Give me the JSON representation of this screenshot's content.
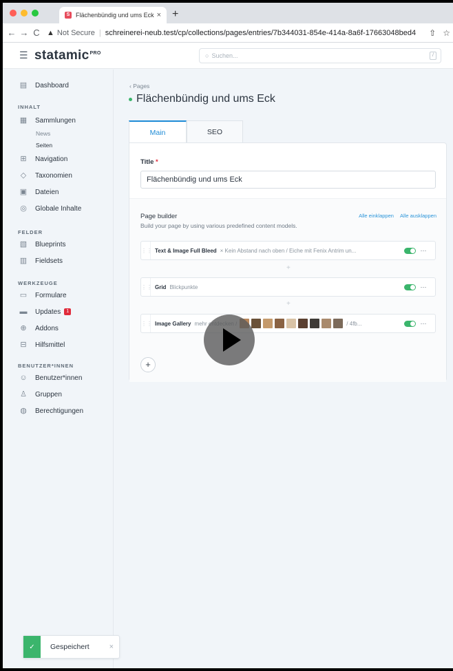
{
  "browser": {
    "tab_title": "Flächenbündig und ums Eck",
    "tab_title_suffix": "‹ |",
    "tab_close": "×",
    "new_tab": "+",
    "security_label": "Not Secure",
    "url": "schreinerei-neub.test/cp/collections/pages/entries/7b344031-854e-414a-8a6f-17663048bed4",
    "favicon_letter": "S"
  },
  "app": {
    "logo": "statamic",
    "logo_badge": "PRO",
    "search_placeholder": "Suchen...",
    "search_shortcut": "/"
  },
  "sidebar": {
    "dashboard": "Dashboard",
    "section_content": "INHALT",
    "collections": "Sammlungen",
    "sub_news": "News",
    "sub_pages": "Seiten",
    "navigation": "Navigation",
    "taxonomies": "Taxonomien",
    "files": "Dateien",
    "globals": "Globale Inhalte",
    "section_fields": "FELDER",
    "blueprints": "Blueprints",
    "fieldsets": "Fieldsets",
    "section_tools": "WERKZEUGE",
    "forms": "Formulare",
    "updates": "Updates",
    "updates_count": "1",
    "addons": "Addons",
    "utilities": "Hilfsmittel",
    "section_users": "BENUTZER*INNEN",
    "users": "Benutzer*innen",
    "groups": "Gruppen",
    "permissions": "Berechtigungen"
  },
  "entry": {
    "breadcrumb": "‹ Pages",
    "title": "Flächenbündig und ums Eck",
    "tabs": [
      "Main",
      "SEO"
    ],
    "title_field_label": "Title",
    "required_mark": "*",
    "title_value": "Flächenbündig und ums Eck",
    "page_builder_label": "Page builder",
    "page_builder_help": "Build your page by using various predefined content models.",
    "collapse_all": "Alle einklappen",
    "expand_all": "Alle ausklappen",
    "sets": [
      {
        "name": "Text & Image Full Bleed",
        "summary": "× Kein Abstand nach oben / Eiche mit Fenix Antrim un..."
      },
      {
        "name": "Grid",
        "summary": "Blickpunkte"
      },
      {
        "name": "Image Gallery",
        "summary": "mehr entdecken /",
        "summary_after": "/ 4fb..."
      }
    ],
    "gallery_thumb_colors": [
      "#b8865a",
      "#6a5138",
      "#c49a6c",
      "#8a6242",
      "#d9c3a6",
      "#5b4030",
      "#3e3a36",
      "#a98a6c",
      "#7c6a5a"
    ]
  },
  "toast": {
    "message": "Gespeichert",
    "close": "×"
  },
  "colors": {
    "accent": "#1d8bd6",
    "success": "#3bb56c",
    "danger": "#e02b3b"
  }
}
